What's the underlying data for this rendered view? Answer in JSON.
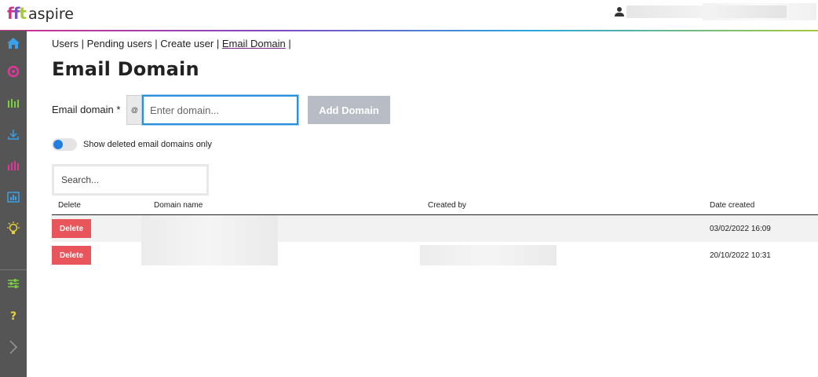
{
  "header": {
    "logo_text": "aspire",
    "accent_colors": [
      "#d0308f",
      "#7b4cc4",
      "#2aa7e0",
      "#a6c93a"
    ]
  },
  "sidebar": {
    "items": [
      {
        "icon": "home-icon",
        "color": "#3aa0e8"
      },
      {
        "icon": "target-icon",
        "color": "#e2379a"
      },
      {
        "icon": "bar-grid-icon",
        "color": "#7cd040"
      },
      {
        "icon": "download-icon",
        "color": "#3aa0e8"
      },
      {
        "icon": "bar-chart-icon",
        "color": "#e2379a"
      },
      {
        "icon": "report-icon",
        "color": "#3aa0e8"
      },
      {
        "icon": "lightbulb-icon",
        "color": "#e8d23a"
      },
      {
        "icon": "sliders-icon",
        "color": "#7cd040"
      },
      {
        "icon": "help-icon",
        "color": "#e8d23a"
      },
      {
        "icon": "chevron-right-icon",
        "color": "#999999"
      }
    ]
  },
  "breadcrumb": {
    "users": "Users",
    "sep1": " | ",
    "pending": "Pending users",
    "sep2": " | ",
    "create": "Create user",
    "sep3": " | ",
    "email_domain": "Email Domain",
    "sep4": " |"
  },
  "page_title": "Email Domain",
  "form": {
    "label": "Email domain *",
    "addon_symbol": "@",
    "input_placeholder": "Enter domain...",
    "input_value": "",
    "add_button": "Add Domain"
  },
  "toggle": {
    "label": "Show deleted email domains only",
    "on": false
  },
  "search": {
    "placeholder": "Search..."
  },
  "table": {
    "headers": {
      "delete": "Delete",
      "domain": "Domain name",
      "created_by": "Created by",
      "date_created": "Date created"
    },
    "rows": [
      {
        "delete_label": "Delete",
        "date_created": "03/02/2022 16:09"
      },
      {
        "delete_label": "Delete",
        "date_created": "20/10/2022 10:31"
      }
    ]
  }
}
